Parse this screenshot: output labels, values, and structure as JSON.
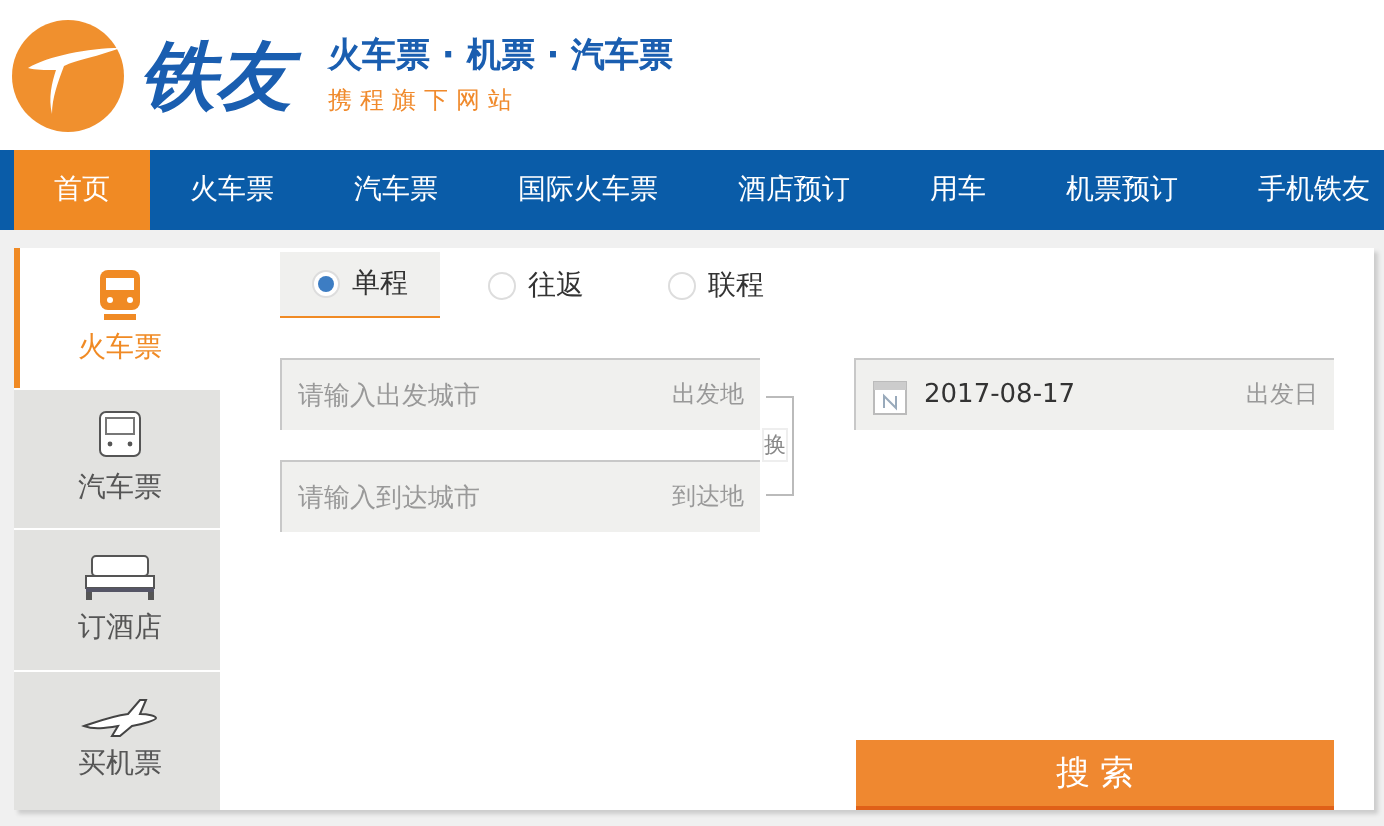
{
  "logo": {
    "name": "铁友",
    "tagline": "火车票 · 机票 · 汽车票",
    "subtitle": "携程旗下网站"
  },
  "nav": [
    {
      "label": "首页",
      "selected": true
    },
    {
      "label": "火车票",
      "selected": false
    },
    {
      "label": "汽车票",
      "selected": false
    },
    {
      "label": "国际火车票",
      "selected": false
    },
    {
      "label": "酒店预订",
      "selected": false
    },
    {
      "label": "用车",
      "selected": false
    },
    {
      "label": "机票预订",
      "selected": false
    },
    {
      "label": "手机铁友",
      "selected": false
    }
  ],
  "sidebar": [
    {
      "kind": "train",
      "label": "火车票",
      "selected": true
    },
    {
      "kind": "bus",
      "label": "汽车票",
      "selected": false
    },
    {
      "kind": "hotel",
      "label": "订酒店",
      "selected": false
    },
    {
      "kind": "plane",
      "label": "买机票",
      "selected": false
    }
  ],
  "trip_types": [
    {
      "label": "单程",
      "selected": true
    },
    {
      "label": "往返",
      "selected": false
    },
    {
      "label": "联程",
      "selected": false
    }
  ],
  "from": {
    "placeholder": "请输入出发城市",
    "tag": "出发地"
  },
  "to": {
    "placeholder": "请输入到达城市",
    "tag": "到达地"
  },
  "swap": "换",
  "date": {
    "value": "2017-08-17",
    "tag": "出发日"
  },
  "search_button": "搜 索"
}
